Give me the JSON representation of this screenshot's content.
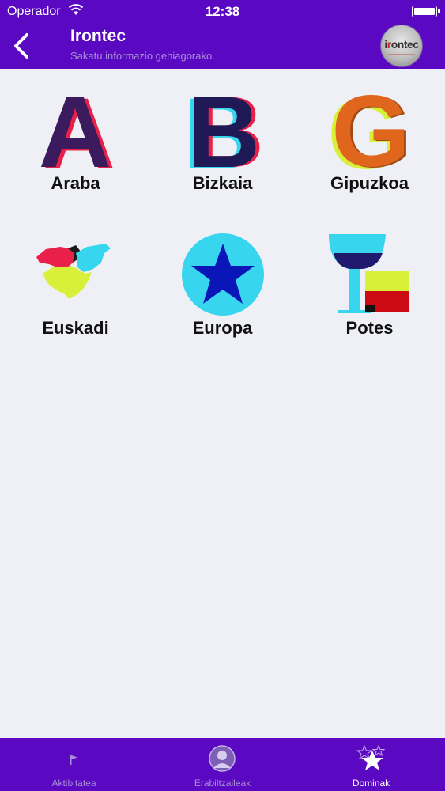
{
  "status_bar": {
    "carrier": "Operador",
    "time": "12:38"
  },
  "nav": {
    "title": "Irontec",
    "subtitle": "Sakatu informazio gehiagorako.",
    "avatar_text_left": "i",
    "avatar_text_r": "r",
    "avatar_text_right": "ontec"
  },
  "medals": [
    {
      "label": "Araba",
      "icon": "letter-a-icon"
    },
    {
      "label": "Bizkaia",
      "icon": "letter-b-icon"
    },
    {
      "label": "Gipuzkoa",
      "icon": "letter-g-icon"
    },
    {
      "label": "Euskadi",
      "icon": "euskadi-map-icon"
    },
    {
      "label": "Europa",
      "icon": "star-circle-icon"
    },
    {
      "label": "Potes",
      "icon": "wine-glass-icon"
    }
  ],
  "tabs": [
    {
      "label": "Aktibitatea",
      "icon": "flag-icon",
      "active": false
    },
    {
      "label": "Erabiltzaileak",
      "icon": "user-icon",
      "active": false
    },
    {
      "label": "Dominak",
      "icon": "stars-icon",
      "active": true
    }
  ],
  "colors": {
    "primary": "#5a08c2",
    "background": "#eef0f5",
    "tab_inactive": "#a98ed8",
    "tab_active": "#ffffff"
  }
}
